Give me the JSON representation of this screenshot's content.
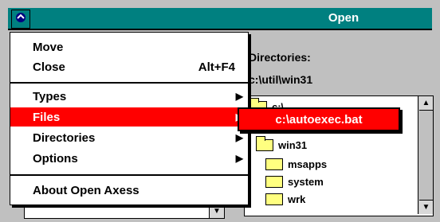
{
  "window": {
    "title": "Open"
  },
  "sysmenu": {
    "items": [
      {
        "label": "Move",
        "shortcut": ""
      },
      {
        "label": "Close",
        "shortcut": "Alt+F4"
      },
      {
        "label": "Types",
        "submenu": true
      },
      {
        "label": "Files",
        "submenu": true,
        "highlight": true
      },
      {
        "label": "Directories",
        "submenu": true
      },
      {
        "label": "Options",
        "submenu": true
      },
      {
        "label": "About Open Axess"
      }
    ]
  },
  "submenu": {
    "items": [
      {
        "label": "c:\\autoexec.bat"
      }
    ]
  },
  "dialog": {
    "directories_label": "Directories:",
    "current_path": "c:\\util\\win31",
    "tree": [
      {
        "label": "c:\\",
        "level": 0,
        "open": true
      },
      {
        "label": "win31",
        "level": 1,
        "open": true
      },
      {
        "label": "msapps",
        "level": 2,
        "open": false
      },
      {
        "label": "system",
        "level": 2,
        "open": false
      },
      {
        "label": "wrk",
        "level": 2,
        "open": false
      }
    ]
  }
}
